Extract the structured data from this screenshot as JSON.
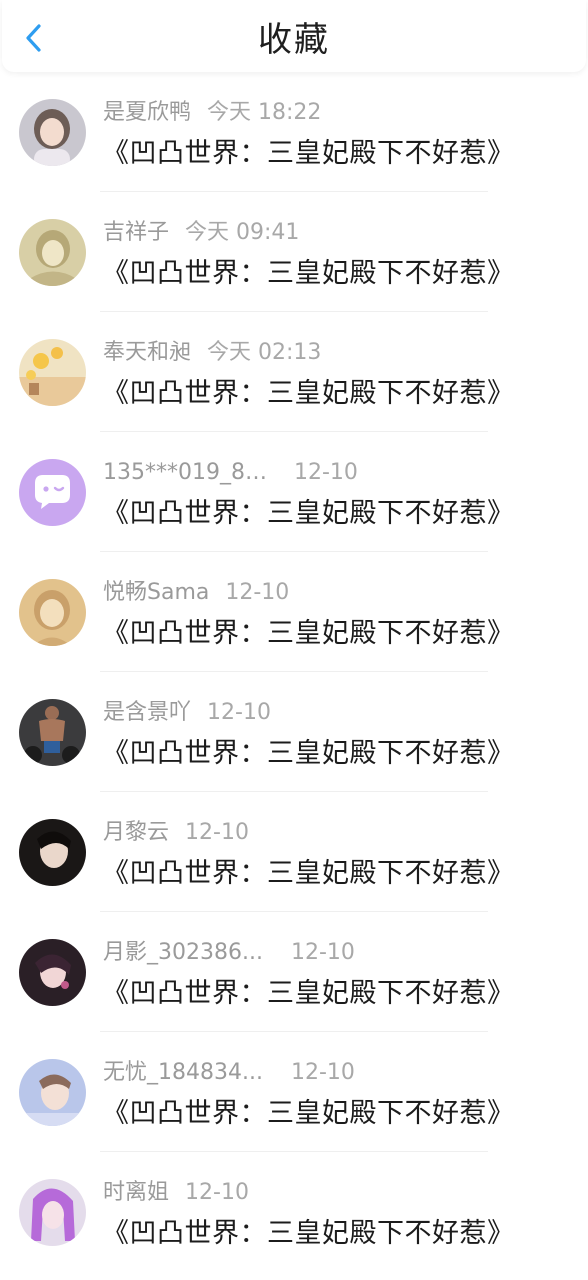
{
  "header": {
    "title": "收藏",
    "back_icon": "chevron-left-icon",
    "accent_color": "#2e9df0"
  },
  "items": [
    {
      "name": "是夏欣鸭",
      "time": "今天 18:22",
      "content": "《凹凸世界：三皇妃殿下不好惹》"
    },
    {
      "name": "吉祥子",
      "time": "今天 09:41",
      "content": "《凹凸世界：三皇妃殿下不好惹》"
    },
    {
      "name": "奉天和昶",
      "time": "今天 02:13",
      "content": "《凹凸世界：三皇妃殿下不好惹》"
    },
    {
      "name": "135***019_84...",
      "time": "12-10",
      "content": "《凹凸世界：三皇妃殿下不好惹》"
    },
    {
      "name": "悦畅Sama",
      "time": "12-10",
      "content": "《凹凸世界：三皇妃殿下不好惹》"
    },
    {
      "name": "是含景吖",
      "time": "12-10",
      "content": "《凹凸世界：三皇妃殿下不好惹》"
    },
    {
      "name": "月黎云",
      "time": "12-10",
      "content": "《凹凸世界：三皇妃殿下不好惹》"
    },
    {
      "name": "月影_302386...",
      "time": "12-10",
      "content": "《凹凸世界：三皇妃殿下不好惹》"
    },
    {
      "name": "无忧_184834...",
      "time": "12-10",
      "content": "《凹凸世界：三皇妃殿下不好惹》"
    },
    {
      "name": "时离姐",
      "time": "12-10",
      "content": "《凹凸世界：三皇妃殿下不好惹》"
    }
  ]
}
